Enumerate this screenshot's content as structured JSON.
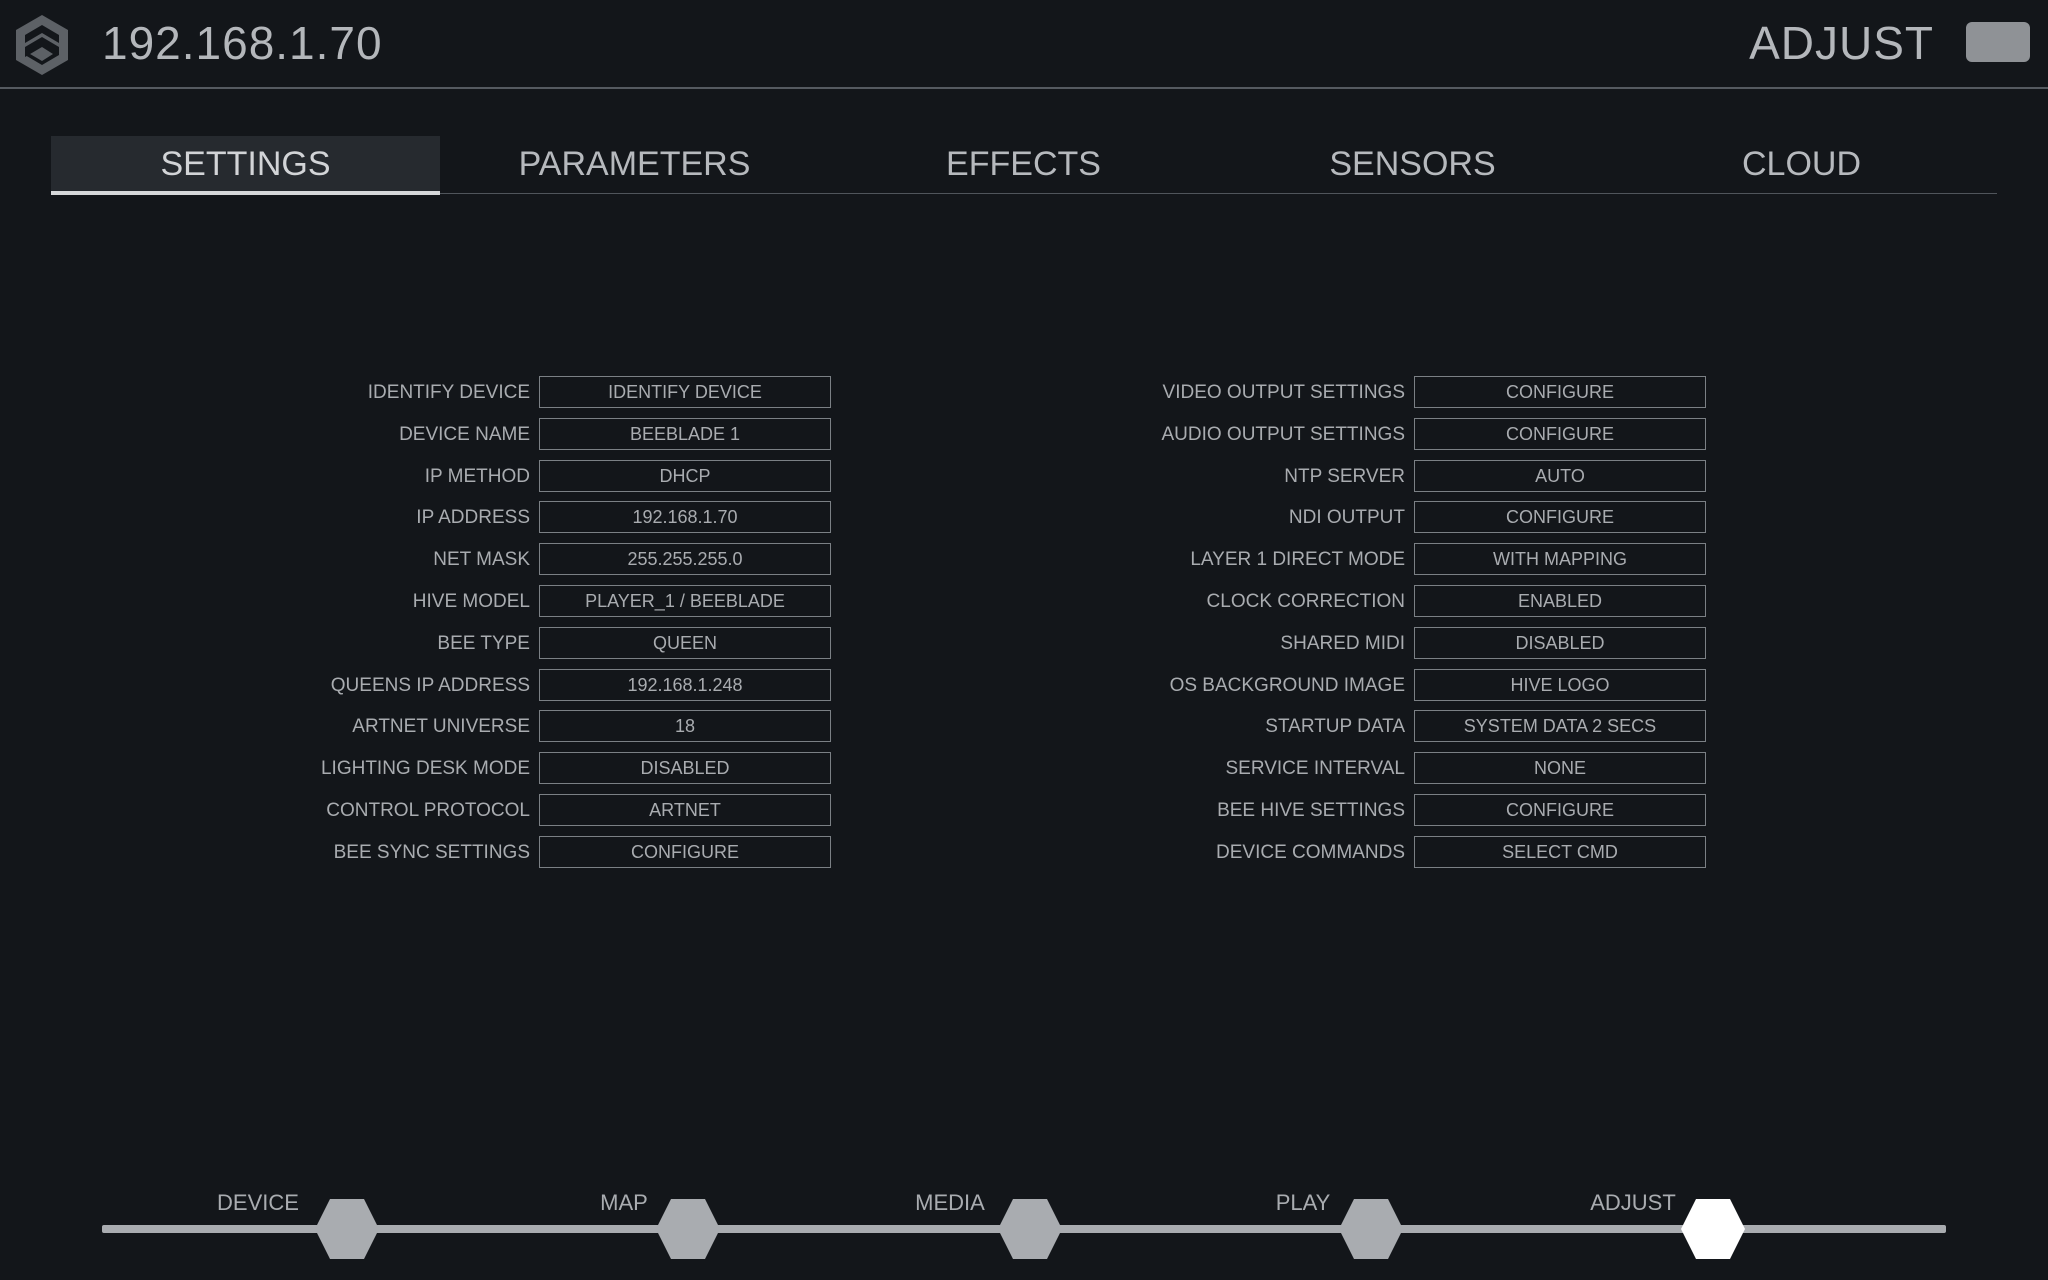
{
  "header": {
    "ip": "192.168.1.70",
    "mode": "ADJUST"
  },
  "tabs": [
    {
      "label": "SETTINGS",
      "active": true
    },
    {
      "label": "PARAMETERS",
      "active": false
    },
    {
      "label": "EFFECTS",
      "active": false
    },
    {
      "label": "SENSORS",
      "active": false
    },
    {
      "label": "CLOUD",
      "active": false
    }
  ],
  "settings_left": [
    {
      "label": "IDENTIFY DEVICE",
      "value": "IDENTIFY DEVICE"
    },
    {
      "label": "DEVICE NAME",
      "value": "BEEBLADE 1"
    },
    {
      "label": "IP METHOD",
      "value": "DHCP"
    },
    {
      "label": "IP ADDRESS",
      "value": "192.168.1.70"
    },
    {
      "label": "NET MASK",
      "value": "255.255.255.0"
    },
    {
      "label": "HIVE MODEL",
      "value": "PLAYER_1 / BEEBLADE"
    },
    {
      "label": "BEE TYPE",
      "value": "QUEEN"
    },
    {
      "label": "QUEENS IP ADDRESS",
      "value": "192.168.1.248"
    },
    {
      "label": "ARTNET UNIVERSE",
      "value": "18"
    },
    {
      "label": "LIGHTING DESK MODE",
      "value": "DISABLED"
    },
    {
      "label": "CONTROL PROTOCOL",
      "value": "ARTNET"
    },
    {
      "label": "BEE SYNC SETTINGS",
      "value": "CONFIGURE"
    }
  ],
  "settings_right": [
    {
      "label": "VIDEO OUTPUT SETTINGS",
      "value": "CONFIGURE"
    },
    {
      "label": "AUDIO OUTPUT SETTINGS",
      "value": "CONFIGURE"
    },
    {
      "label": "NTP SERVER",
      "value": "AUTO"
    },
    {
      "label": "NDI OUTPUT",
      "value": "CONFIGURE"
    },
    {
      "label": "LAYER 1 DIRECT MODE",
      "value": "WITH MAPPING"
    },
    {
      "label": "CLOCK CORRECTION",
      "value": "ENABLED"
    },
    {
      "label": "SHARED MIDI",
      "value": "DISABLED"
    },
    {
      "label": "OS BACKGROUND IMAGE",
      "value": "HIVE LOGO"
    },
    {
      "label": "STARTUP DATA",
      "value": "SYSTEM DATA 2 SECS"
    },
    {
      "label": "SERVICE INTERVAL",
      "value": "NONE"
    },
    {
      "label": "BEE HIVE SETTINGS",
      "value": "CONFIGURE"
    },
    {
      "label": "DEVICE COMMANDS",
      "value": "SELECT CMD"
    }
  ],
  "workflow_steps": [
    {
      "label": "DEVICE",
      "active": false
    },
    {
      "label": "MAP",
      "active": false
    },
    {
      "label": "MEDIA",
      "active": false
    },
    {
      "label": "PLAY",
      "active": false
    },
    {
      "label": "ADJUST",
      "active": true
    }
  ],
  "colors": {
    "background": "#13161a",
    "text": "#a9acb0",
    "inactive_step": "#a9acb0",
    "active_step": "#ffffff"
  },
  "icons": {
    "logo": "hive-logo-icon",
    "step": "hexagon-icon"
  }
}
